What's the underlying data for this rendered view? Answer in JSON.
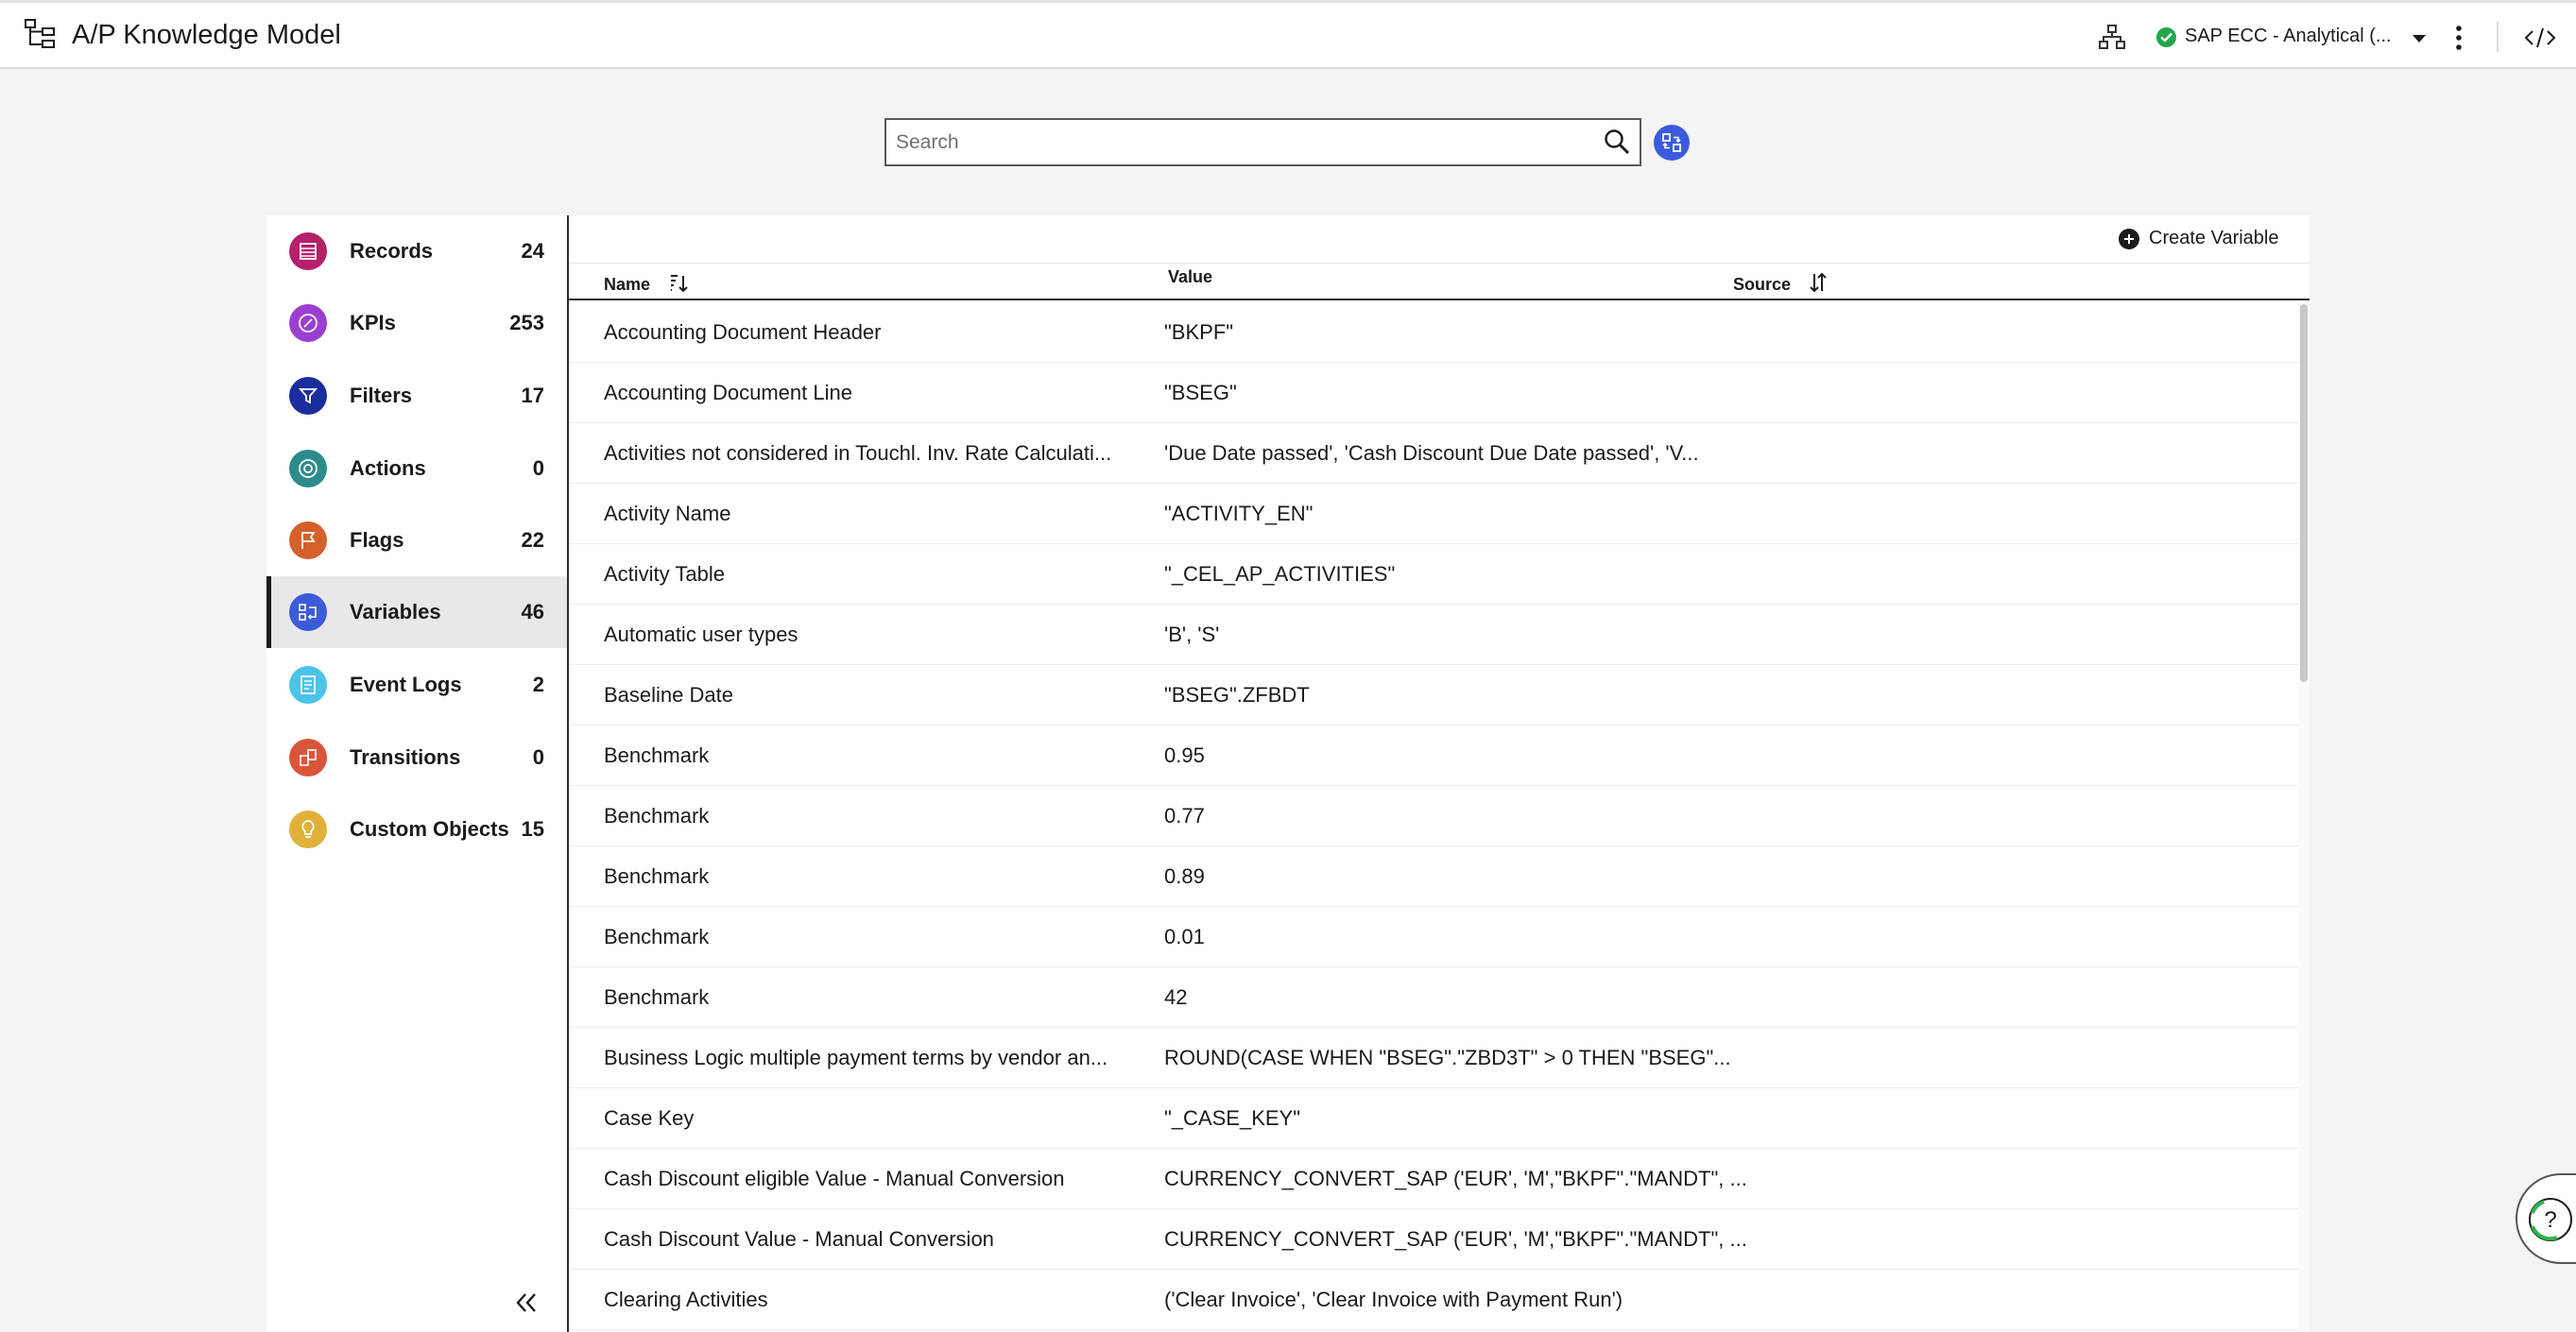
{
  "header": {
    "title": "A/P Knowledge Model",
    "connection": "SAP ECC - Analytical (...",
    "icons": [
      "knowledge-model-icon",
      "hierarchy-icon",
      "status-check-icon",
      "caret-down-icon",
      "more-vertical-icon",
      "code-icon"
    ],
    "status_color": "#23a64a"
  },
  "search": {
    "placeholder": "Search",
    "value": ""
  },
  "sidebar": {
    "items": [
      {
        "label": "Records",
        "count": "24",
        "icon": "records-icon",
        "color": "#b5206b"
      },
      {
        "label": "KPIs",
        "count": "253",
        "icon": "kpi-icon",
        "color": "#9a3fd0"
      },
      {
        "label": "Filters",
        "count": "17",
        "icon": "filter-icon",
        "color": "#1a2d9e"
      },
      {
        "label": "Actions",
        "count": "0",
        "icon": "actions-icon",
        "color": "#2e8b8b"
      },
      {
        "label": "Flags",
        "count": "22",
        "icon": "flag-icon",
        "color": "#d4602a"
      },
      {
        "label": "Variables",
        "count": "46",
        "icon": "variables-icon",
        "color": "#3b5bdb"
      },
      {
        "label": "Event Logs",
        "count": "2",
        "icon": "event-logs-icon",
        "color": "#4cc3e8"
      },
      {
        "label": "Transitions",
        "count": "0",
        "icon": "transitions-icon",
        "color": "#d9553a"
      },
      {
        "label": "Custom Objects",
        "count": "15",
        "icon": "custom-objects-icon",
        "color": "#e0b03a"
      }
    ],
    "active": "Variables"
  },
  "main": {
    "create_label": "Create Variable",
    "columns": {
      "name": "Name",
      "value": "Value",
      "source": "Source"
    },
    "rows": [
      {
        "name": "Accounting Document Header",
        "value": "\"BKPF\""
      },
      {
        "name": "Accounting Document Line",
        "value": "\"BSEG\""
      },
      {
        "name": "Activities not considered in Touchl. Inv. Rate Calculati...",
        "value": "'Due Date passed', 'Cash Discount Due Date passed', 'V..."
      },
      {
        "name": "Activity Name",
        "value": "\"ACTIVITY_EN\""
      },
      {
        "name": "Activity Table",
        "value": "\"_CEL_AP_ACTIVITIES\""
      },
      {
        "name": "Automatic user types",
        "value": "'B', 'S'"
      },
      {
        "name": "Baseline Date",
        "value": "\"BSEG\".ZFBDT"
      },
      {
        "name": "Benchmark",
        "value": "0.95"
      },
      {
        "name": "Benchmark",
        "value": "0.77"
      },
      {
        "name": "Benchmark",
        "value": "0.89"
      },
      {
        "name": "Benchmark",
        "value": "0.01"
      },
      {
        "name": "Benchmark",
        "value": "42"
      },
      {
        "name": "Business Logic multiple payment terms by vendor an...",
        "value": "ROUND(CASE WHEN \"BSEG\".\"ZBD3T\" > 0 THEN \"BSEG\"..."
      },
      {
        "name": "Case Key",
        "value": "\"_CASE_KEY\""
      },
      {
        "name": "Cash Discount eligible Value - Manual Conversion",
        "value": "CURRENCY_CONVERT_SAP ('EUR', 'M',\"BKPF\".\"MANDT\", ..."
      },
      {
        "name": "Cash Discount Value - Manual Conversion",
        "value": "CURRENCY_CONVERT_SAP ('EUR', 'M',\"BKPF\".\"MANDT\", ..."
      },
      {
        "name": "Clearing Activities",
        "value": "('Clear Invoice', 'Clear Invoice with Payment Run')"
      }
    ]
  },
  "help": {
    "icon": "help-icon"
  }
}
